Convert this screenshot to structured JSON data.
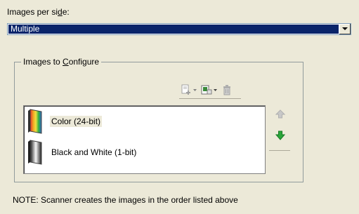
{
  "images_per_side": {
    "label_pre": "Images per si",
    "label_mnemonic": "d",
    "label_post": "e:",
    "value": "Multiple"
  },
  "group": {
    "title_pre": "Images to ",
    "title_mnemonic": "C",
    "title_post": "onfigure"
  },
  "toolbar": {
    "add_icon": "add-image-icon",
    "change_icon": "change-image-icon",
    "delete_icon": "trash-icon"
  },
  "images": [
    {
      "label": "Color (24-bit)",
      "icon": "color-image-icon",
      "selected": true
    },
    {
      "label": "Black and White (1-bit)",
      "icon": "bw-image-icon",
      "selected": false
    }
  ],
  "reorder": {
    "up_icon": "arrow-up-icon",
    "down_icon": "arrow-down-icon"
  },
  "note": "NOTE: Scanner creates the images in the order listed above",
  "colors": {
    "selection": "#0a246a",
    "background": "#ece9d8",
    "arrow_down": "#1e9a2e",
    "arrow_up_disabled": "#c0c0c0"
  }
}
